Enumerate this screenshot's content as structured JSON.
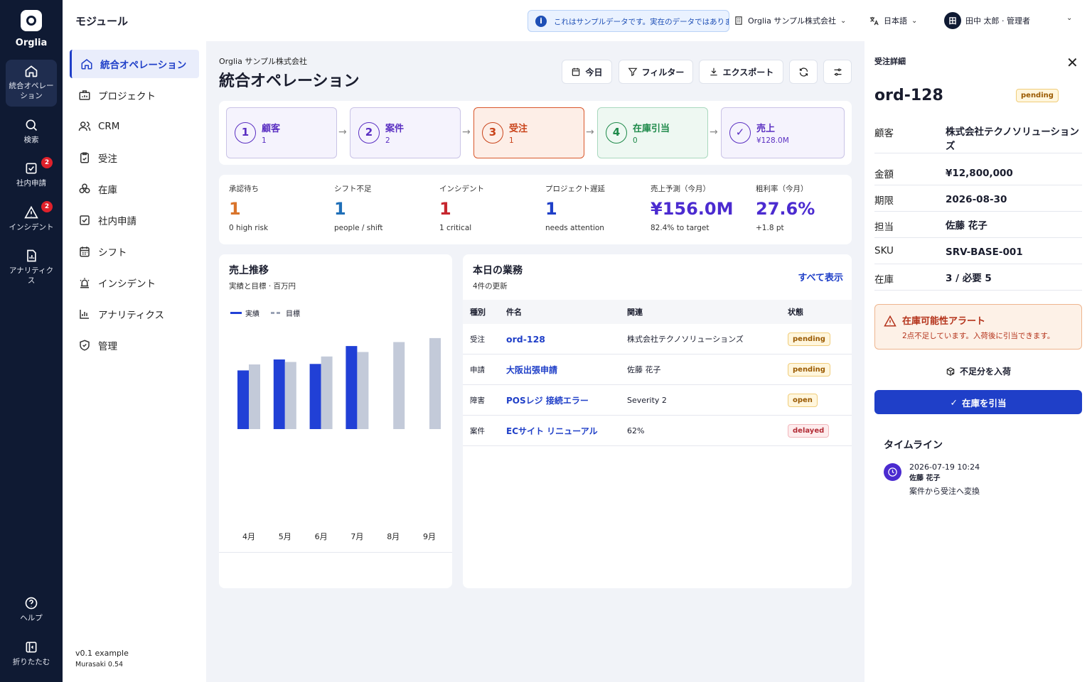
{
  "rail": {
    "brand": "Orglia",
    "items": [
      {
        "label": "統合オペレーション",
        "icon": "home-icon"
      },
      {
        "label": "検索",
        "icon": "search-icon"
      },
      {
        "label": "社内申請",
        "icon": "checkbox-icon",
        "badge": "2"
      },
      {
        "label": "インシデント",
        "icon": "alert-triangle-icon",
        "badge": "2"
      },
      {
        "label": "アナリティクス",
        "icon": "document-chart-icon"
      },
      {
        "label": "ヘルプ",
        "icon": "help-icon"
      },
      {
        "label": "折りたたむ",
        "icon": "collapse-icon"
      }
    ]
  },
  "topbar": {
    "module_title": "モジュール",
    "notice": "これはサンプルデータです。実在のデータではありません。",
    "org": "Orglia サンプル株式会社",
    "language": "日本語",
    "avatar_initial": "田",
    "user": "田中 太郎 · 管理者"
  },
  "sidenav": {
    "items": [
      {
        "label": "統合オペレーション",
        "icon": "home-icon"
      },
      {
        "label": "プロジェクト",
        "icon": "briefcase-icon"
      },
      {
        "label": "CRM",
        "icon": "users-icon"
      },
      {
        "label": "受注",
        "icon": "clipboard-icon"
      },
      {
        "label": "在庫",
        "icon": "boxes-icon"
      },
      {
        "label": "社内申請",
        "icon": "checkbox-icon"
      },
      {
        "label": "シフト",
        "icon": "calendar-icon"
      },
      {
        "label": "インシデント",
        "icon": "siren-icon"
      },
      {
        "label": "アナリティクス",
        "icon": "bar-chart-icon"
      },
      {
        "label": "管理",
        "icon": "shield-icon"
      }
    ],
    "version": "v0.1 example",
    "version_sub": "Murasaki 0.54"
  },
  "main": {
    "org": "Orglia サンプル株式会社",
    "title": "統合オペレーション",
    "buttons": {
      "today": "今日",
      "filter": "フィルター",
      "export": "エクスポート"
    }
  },
  "pipeline": [
    {
      "num": "1",
      "label": "顧客",
      "value": "1"
    },
    {
      "num": "2",
      "label": "案件",
      "value": "2"
    },
    {
      "num": "3",
      "label": "受注",
      "value": "1"
    },
    {
      "num": "4",
      "label": "在庫引当",
      "value": "0"
    },
    {
      "num": "✓",
      "label": "売上",
      "value": "¥128.0M"
    }
  ],
  "kpis": [
    {
      "label": "承認待ち",
      "value": "1",
      "sub": "0 high risk",
      "color": "#d9742b"
    },
    {
      "label": "シフト不足",
      "value": "1",
      "sub": "people / shift",
      "color": "#1f6fb8"
    },
    {
      "label": "インシデント",
      "value": "1",
      "sub": "1 critical",
      "color": "#c6262e"
    },
    {
      "label": "プロジェクト遅延",
      "value": "1",
      "sub": "needs attention",
      "color": "#1f3fc8"
    },
    {
      "label": "売上予測（今月）",
      "value": "¥156.0M",
      "sub": "82.4% to target",
      "color": "#4b2bd0"
    },
    {
      "label": "粗利率（今月）",
      "value": "27.6%",
      "sub": "+1.8 pt",
      "color": "#4b2bd0"
    }
  ],
  "chart_card": {
    "title": "売上推移",
    "subtitle": "実績と目標 · 百万円"
  },
  "chart_data": {
    "type": "bar",
    "categories": [
      "4月",
      "5月",
      "6月",
      "7月",
      "8月",
      "9月"
    ],
    "series": [
      {
        "name": "実績",
        "values": [
          118,
          140,
          131,
          167,
          null,
          null
        ],
        "color": "#2140d6"
      },
      {
        "name": "目標",
        "values": [
          130,
          135,
          146,
          155,
          175,
          183
        ],
        "color": "#c3cad9"
      }
    ],
    "legend": "top-left",
    "grid": false
  },
  "tasks": {
    "title": "本日の業務",
    "subtitle": "4件の更新",
    "view_all": "すべて表示",
    "columns": [
      "種別",
      "件名",
      "関連",
      "状態"
    ],
    "rows": [
      {
        "type": "受注",
        "name": "ord-128",
        "related": "株式会社テクノソリューションズ",
        "status": "pending",
        "status_kind": "pending"
      },
      {
        "type": "申請",
        "name": "大阪出張申請",
        "related": "佐藤 花子",
        "status": "pending",
        "status_kind": "pending"
      },
      {
        "type": "障害",
        "name": "POSレジ 接続エラー",
        "related": "Severity 2",
        "status": "open",
        "status_kind": "open"
      },
      {
        "type": "案件",
        "name": "ECサイト リニューアル",
        "related": "62%",
        "status": "delayed",
        "status_kind": "delayed"
      }
    ]
  },
  "detail": {
    "header": "受注詳細",
    "id": "ord-128",
    "status": "pending",
    "fields": [
      {
        "label": "顧客",
        "value": "株式会社テクノソリューションズ"
      },
      {
        "label": "金額",
        "value": "¥12,800,000"
      },
      {
        "label": "期限",
        "value": "2026-08-30"
      },
      {
        "label": "担当",
        "value": "佐藤 花子"
      },
      {
        "label": "SKU",
        "value": "SRV-BASE-001"
      },
      {
        "label": "在庫",
        "value": "3 / 必要 5"
      }
    ],
    "alert_title": "在庫可能性アラート",
    "alert_desc": "2点不足しています。入荷後に引当できます。",
    "receive_label": "不足分を入荷",
    "allocate_label": "在庫を引当",
    "timeline_title": "タイムライン",
    "timeline": [
      {
        "time": "2026-07-19 10:24",
        "user": "佐藤 花子",
        "text": "案件から受注へ変換"
      }
    ]
  }
}
